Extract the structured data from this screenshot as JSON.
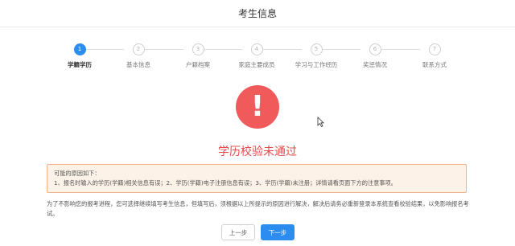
{
  "header": {
    "title": "考生信息"
  },
  "steps": [
    {
      "number": "1",
      "label": "学籍学历"
    },
    {
      "number": "2",
      "label": "基本信息"
    },
    {
      "number": "3",
      "label": "户籍档案"
    },
    {
      "number": "4",
      "label": "家庭主要成员"
    },
    {
      "number": "5",
      "label": "学习与工作经历"
    },
    {
      "number": "6",
      "label": "奖惩情况"
    },
    {
      "number": "7",
      "label": "联系方式"
    }
  ],
  "active_step": 1,
  "result": {
    "icon_glyph": "!",
    "title": "学历校验未通过"
  },
  "reasons": {
    "heading": "可能的原因如下：",
    "text": "1、报名时输入的学历(学籍)相关信息有误；2、学历(学籍)电子注册信息有误；3、学历(学籍)未注册；详情请看页面下方的注意事项。"
  },
  "note": "为了不影响您的报考进程，您可选择继续填写考生信息，但填写后，须根据以上所提示的原因进行解决，解决后请务必重新登录本系统查看校验结果，以免影响报名考试。",
  "buttons": {
    "prev": "上一步",
    "next": "下一步"
  },
  "colors": {
    "accent": "#2d8cf0",
    "error": "#f05a5a",
    "warning_border": "#f3b38a",
    "warning_bg": "#fdf2e8"
  }
}
